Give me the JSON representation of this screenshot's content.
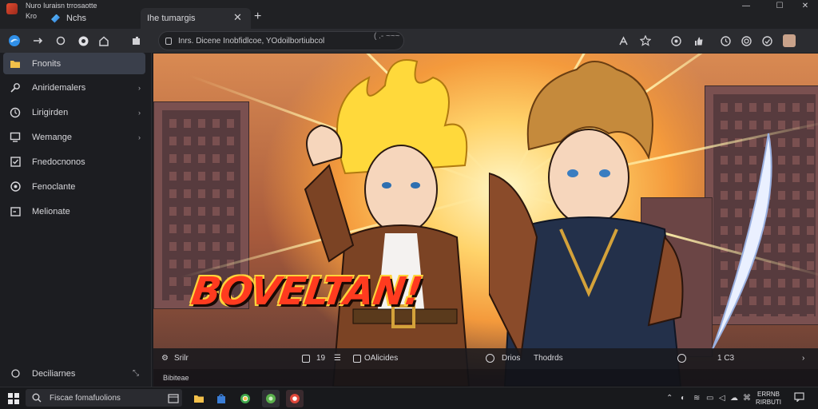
{
  "window": {
    "app_title": "Nuro",
    "app_subtitle": "Kro",
    "app_title_extra": "Iuraisn trrosaotte",
    "tabs": [
      {
        "label": "Nchs"
      },
      {
        "label": "Ihe tumargis"
      }
    ],
    "tab_close": "✕",
    "new_tab": "+",
    "controls": {
      "minimize": "—",
      "maximize": "☐",
      "close": "✕"
    }
  },
  "toolbar": {
    "address": "Inrs. Dicene Inobfidlcoe, YOdoilbortiubcol",
    "address_trail": "( .- ~~~",
    "icons": [
      "browser-logo-icon",
      "forward-icon",
      "refresh-icon",
      "home-icon",
      "extension-icon",
      "translate-icon",
      "bookmark-star-icon",
      "account-icon",
      "share-icon",
      "history-icon",
      "settings-icon",
      "update-icon",
      "profile-avatar-icon"
    ]
  },
  "sidebar": {
    "items": [
      {
        "label": "Fnonits",
        "icon": "folder-icon",
        "active": true,
        "chevron": false
      },
      {
        "label": "Aniridemalers",
        "icon": "puzzle-icon",
        "active": false,
        "chevron": true
      },
      {
        "label": "Lirigirden",
        "icon": "compass-icon",
        "active": false,
        "chevron": true
      },
      {
        "label": "Wemange",
        "icon": "monitor-icon",
        "active": false,
        "chevron": true
      },
      {
        "label": "Fnedocnonos",
        "icon": "checkbox-icon",
        "active": false,
        "chevron": false
      },
      {
        "label": "Fenoclante",
        "icon": "radio-icon",
        "active": false,
        "chevron": false
      },
      {
        "label": "Melionate",
        "icon": "screen-icon",
        "active": false,
        "chevron": false
      }
    ],
    "bottom_label": "Deciliarnes"
  },
  "content": {
    "art_title": "BOVELTAN!"
  },
  "media_bar": {
    "left_label": "Srilr",
    "pill_a": "19",
    "pill_b": "OAlicides",
    "mid_label": "Drios",
    "mid_value": "Thodrds",
    "right_value": "1 C3"
  },
  "status_bar": {
    "text": "Bibiteae"
  },
  "taskbar": {
    "search_placeholder": "Fiscae fomafuolions",
    "clock_time": "ERRNB",
    "clock_date": "RIRBUTI"
  }
}
